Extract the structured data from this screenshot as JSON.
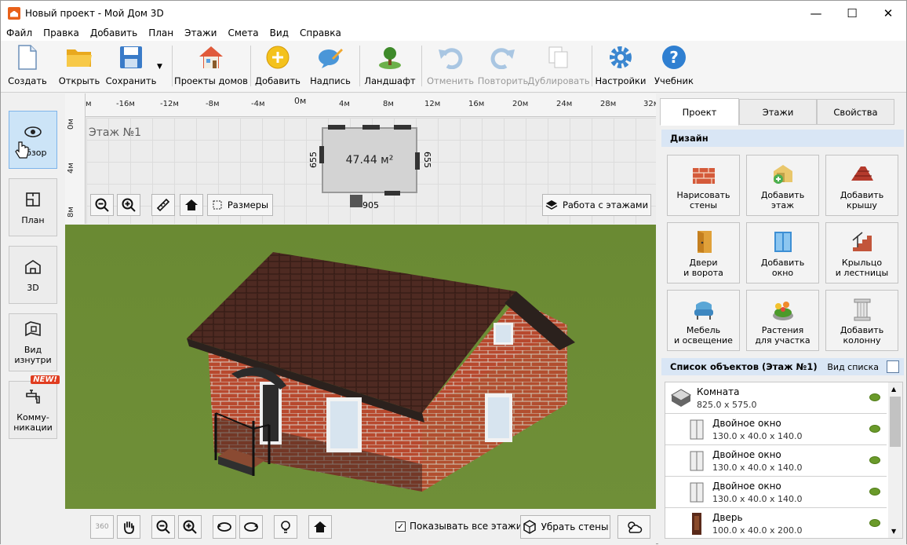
{
  "window": {
    "title": "Новый проект - Мой Дом 3D",
    "minimize": "—",
    "maximize": "☐",
    "close": "✕"
  },
  "menu": [
    "Файл",
    "Правка",
    "Добавить",
    "План",
    "Этажи",
    "Смета",
    "Вид",
    "Справка"
  ],
  "toolbar": {
    "create": "Создать",
    "open": "Открыть",
    "save": "Сохранить",
    "house_projects": "Проекты домов",
    "add": "Добавить",
    "label": "Надпись",
    "landscape": "Ландшафт",
    "undo": "Отменить",
    "redo": "Повторить",
    "duplicate": "Дублировать",
    "settings": "Настройки",
    "tutorial": "Учебник"
  },
  "left": {
    "overview": "Обзор",
    "plan": "План",
    "view3d": "3D",
    "inside_1": "Вид",
    "inside_2": "изнутри",
    "comm_1": "Комму-",
    "comm_2": "никации",
    "new_badge": "NEW!"
  },
  "plan": {
    "ruler_x": [
      "м",
      "-16м",
      "-12м",
      "-8м",
      "-4м",
      "0м",
      "4м",
      "8м",
      "12м",
      "16м",
      "20м",
      "24м",
      "28м",
      "32м"
    ],
    "ruler_y": [
      "0м",
      "4м",
      "8м"
    ],
    "floor_label": "Этаж №1",
    "room_area": "47.44 м²",
    "dim_left": "655",
    "dim_right": "655",
    "dim_bottom": "905",
    "sizes_btn": "Размеры",
    "floors_btn": "Работа с этажами"
  },
  "bottom": {
    "show_all_floors": "Показывать все этажи",
    "remove_walls": "Убрать стены",
    "rotate360": "360"
  },
  "right": {
    "tabs": [
      "Проект",
      "Этажи",
      "Свойства"
    ],
    "design_header": "Дизайн",
    "design": [
      {
        "l1": "Нарисовать",
        "l2": "стены"
      },
      {
        "l1": "Добавить",
        "l2": "этаж"
      },
      {
        "l1": "Добавить",
        "l2": "крышу"
      },
      {
        "l1": "Двери",
        "l2": "и ворота"
      },
      {
        "l1": "Добавить",
        "l2": "окно"
      },
      {
        "l1": "Крыльцо",
        "l2": "и лестницы"
      },
      {
        "l1": "Мебель",
        "l2": "и освещение"
      },
      {
        "l1": "Растения",
        "l2": "для участка"
      },
      {
        "l1": "Добавить",
        "l2": "колонну"
      }
    ],
    "objects_header": "Список объектов (Этаж №1)",
    "list_view": "Вид списка",
    "objects": [
      {
        "name": "Комната",
        "dims": "825.0 x 575.0"
      },
      {
        "name": "Двойное окно",
        "dims": "130.0 x 40.0 x 140.0"
      },
      {
        "name": "Двойное окно",
        "dims": "130.0 x 40.0 x 140.0"
      },
      {
        "name": "Двойное окно",
        "dims": "130.0 x 40.0 x 140.0"
      },
      {
        "name": "Дверь",
        "dims": "100.0 x 40.0 x 200.0"
      }
    ]
  }
}
